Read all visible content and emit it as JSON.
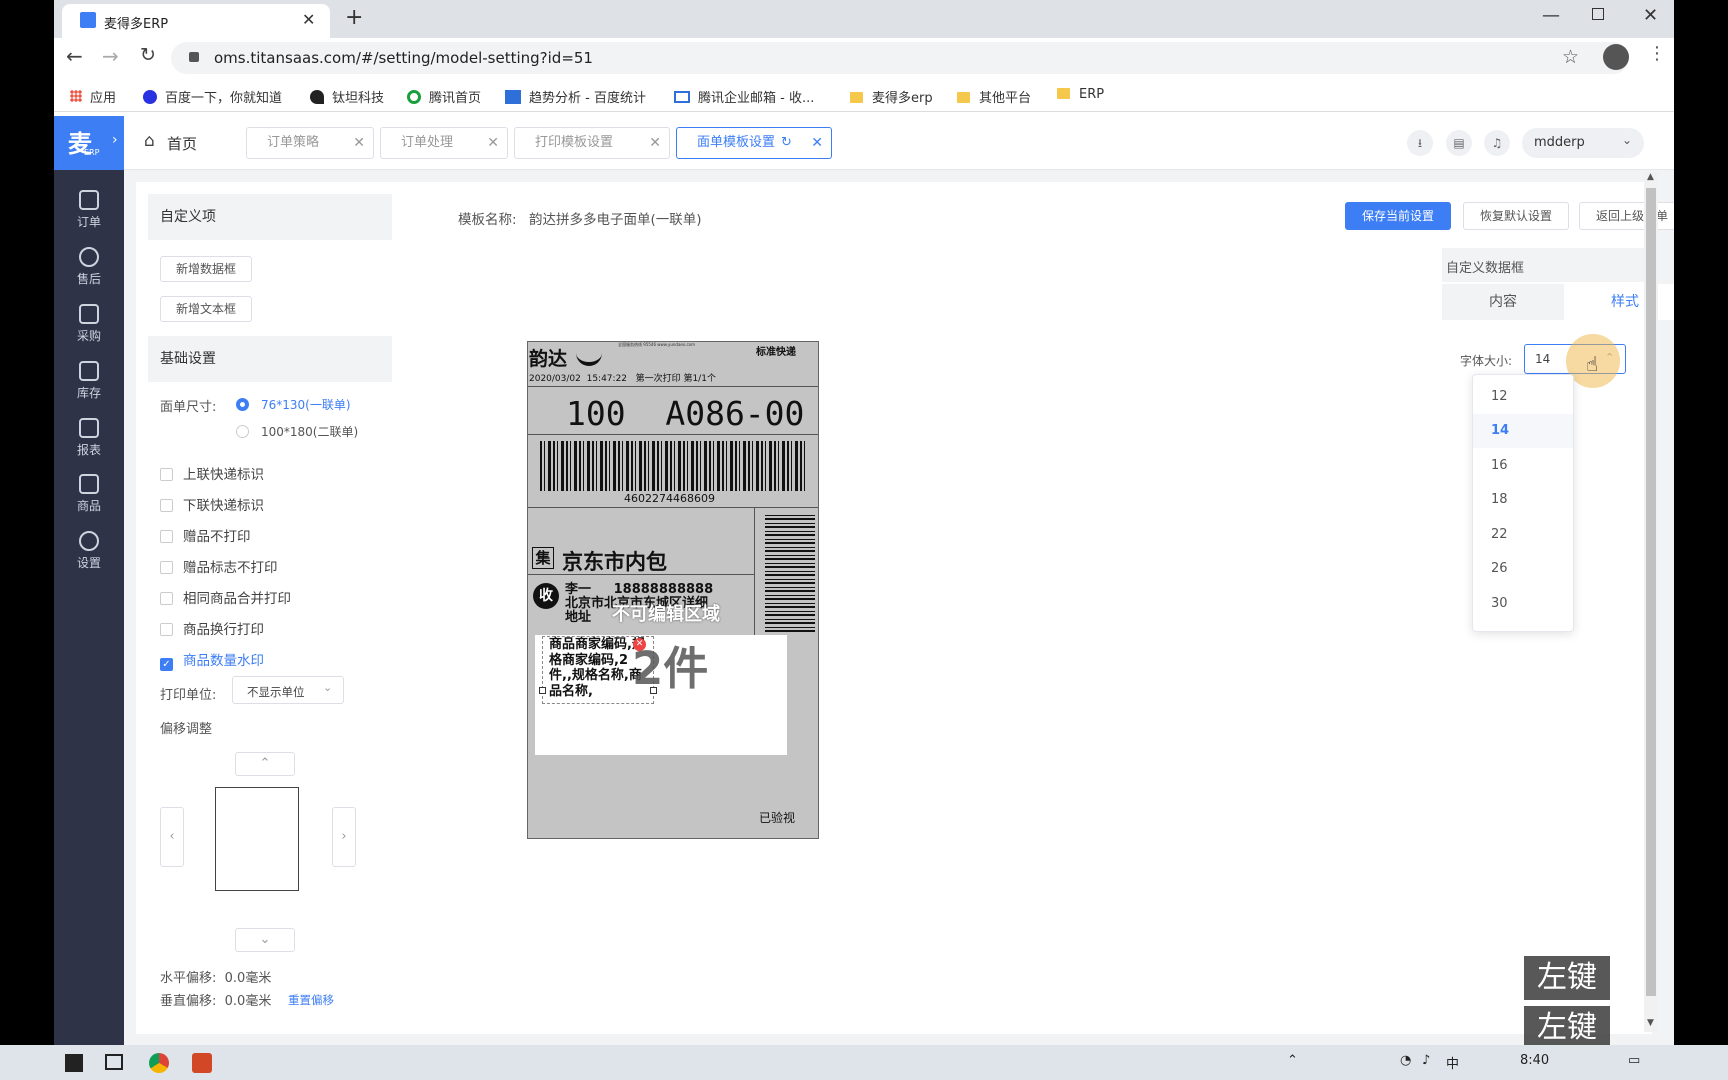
{
  "browser": {
    "tab_title": "麦得多ERP",
    "url": "oms.titansaas.com/#/setting/model-setting?id=51",
    "bookmarks": [
      "应用",
      "百度一下，你就知道",
      "钛坦科技",
      "腾讯首页",
      "趋势分析 - 百度统计",
      "腾讯企业邮箱 - 收...",
      "麦得多erp",
      "其他平台",
      "ERP"
    ]
  },
  "sidenav": {
    "logo": "ERP",
    "items": [
      "订单",
      "售后",
      "采购",
      "库存",
      "报表",
      "商品",
      "设置"
    ]
  },
  "topbar": {
    "home": "首页",
    "tabs": [
      "订单策略",
      "订单处理",
      "打印模板设置",
      "面单模板设置"
    ],
    "user": "mdderp"
  },
  "left": {
    "custom_title": "自定义项",
    "add_data_box": "新增数据框",
    "add_text_box": "新增文本框",
    "basic_title": "基础设置",
    "size_label": "面单尺寸:",
    "size_options": [
      "76*130(一联单)",
      "100*180(二联单)"
    ],
    "checkboxes": [
      "上联快递标识",
      "下联快递标识",
      "赠品不打印",
      "赠品标志不打印",
      "相同商品合并打印",
      "商品换行打印",
      "商品数量水印"
    ],
    "unit_label": "打印单位:",
    "unit_value": "不显示单位",
    "offset_title": "偏移调整",
    "h_offset": "水平偏移:  0.0毫米",
    "v_offset": "垂直偏移:  0.0毫米",
    "reset": "重置偏移"
  },
  "main": {
    "template_label": "模板名称:",
    "template_name": "韵达拼多多电子面单(一联单)",
    "save": "保存当前设置",
    "restore": "恢复默认设置",
    "back": "返回上级菜单"
  },
  "label": {
    "brand": "韵达",
    "top_small": "全国服务热线 95546 www.yundaex.com",
    "type": "标准快递",
    "date": "2020/03/02  15:47:22   第一次打印 第1/1个",
    "code": "100  A086-00",
    "barcode_num": "4602274468609",
    "side_num": "4602274468609",
    "ji": "集",
    "dest": "京东市内包",
    "shou": "收",
    "receiver": "李一     18888888888",
    "address1": "北京市北京市东城区详细",
    "address2": "地址",
    "non_edit": "不可编辑区域",
    "goods": "商品商家编码,规格商家编码,2件,,规格名称,商品名称,",
    "watermark": "2件",
    "checked": "已验视"
  },
  "right": {
    "title": "自定义数据框",
    "tab_content": "内容",
    "tab_style": "样式",
    "font_label": "字体大小:",
    "font_value": "14",
    "options": [
      "12",
      "14",
      "16",
      "18",
      "22",
      "26",
      "30"
    ]
  },
  "overlay": {
    "hint1": "左键",
    "hint2": "左键"
  },
  "taskbar": {
    "time": "8:40",
    "ime": "中"
  }
}
